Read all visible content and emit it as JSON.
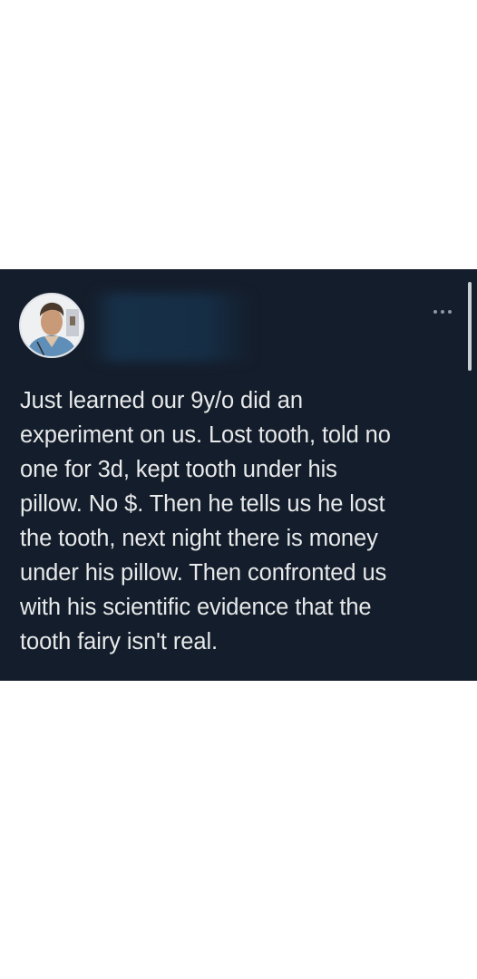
{
  "tweet": {
    "text": "Just learned our 9y/o did an\nexperiment on us.  Lost tooth, told no\none for 3d, kept tooth under his\npillow.  No $.  Then he tells us he lost\nthe tooth, next night there is money\nunder his pillow.  Then confronted us\nwith his scientific evidence that the\ntooth fairy isn't real.",
    "more_icon": "more-horizontal-icon",
    "avatar_icon": "avatar"
  },
  "colors": {
    "card_background": "#141d2b",
    "text": "#e7e9ea",
    "muted_icon": "#8b98a5",
    "page_background": "#ffffff"
  }
}
